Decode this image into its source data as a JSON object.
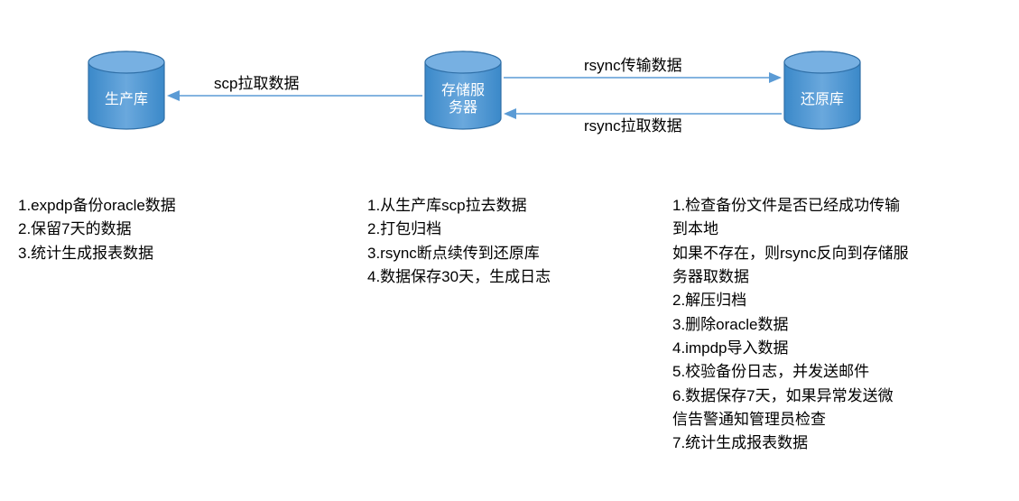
{
  "nodes": {
    "prod": {
      "label": "生产库"
    },
    "storage": {
      "label_line1": "存储服",
      "label_line2": "务器"
    },
    "restore": {
      "label": "还原库"
    }
  },
  "arrows": {
    "scp": "scp拉取数据",
    "rsync_push": "rsync传输数据",
    "rsync_pull": "rsync拉取数据"
  },
  "desc_prod": {
    "l1": "1.expdp备份oracle数据",
    "l2": "2.保留7天的数据",
    "l3": "3.统计生成报表数据"
  },
  "desc_storage": {
    "l1": "1.从生产库scp拉去数据",
    "l2": "2.打包归档",
    "l3": "3.rsync断点续传到还原库",
    "l4": "4.数据保存30天，生成日志"
  },
  "desc_restore": {
    "l1a": "1.检查备份文件是否已经成功传输",
    "l1b": "到本地",
    "l1c": "如果不存在，则rsync反向到存储服",
    "l1d": "务器取数据",
    "l2": "2.解压归档",
    "l3": "3.删除oracle数据",
    "l4": "4.impdp导入数据",
    "l5": "5.校验备份日志，并发送邮件",
    "l6a": "6.数据保存7天，如果异常发送微",
    "l6b": "信告警通知管理员检查",
    "l7": "7.统计生成报表数据"
  }
}
